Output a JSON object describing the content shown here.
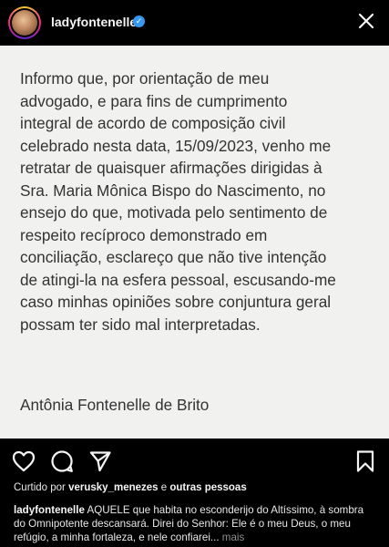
{
  "header": {
    "username": "ladyfontenelle",
    "verified_icon": "✓"
  },
  "post": {
    "body": "Informo que, por orientação de meu\nadvogado, e para fins de cumprimento\nintegral de acordo de composição civil\ncelebrado nesta data, 15/09/2023, venho me\nretratar de quaisquer afirmações dirigidas à\nSra. Maria Mônica Bispo do Nascimento, no\nensejo do que, motivada pelo sentimento de\nrespeito recíproco demonstrado em\nconciliação, esclareço que não tive intenção\nde atingi-la na esfera pessoal, escusando-me\ncaso minhas opiniões sobre conjuntura geral\npossam ter sido mal interpretadas.",
    "signature": "Antônia Fontenelle de Brito"
  },
  "likes": {
    "prefix": "Curtido por ",
    "user": "verusky_menezes",
    "middle": " e ",
    "others": "outras pessoas"
  },
  "caption": {
    "user": "ladyfontenelle",
    "text": " AQUELE que habita no esconderijo do Altíssimo, à sombra do Omnipotente descansará. Direi do Senhor: Ele é o meu Deus, o meu refúgio, a minha fortaleza, e nele confiarei... ",
    "more": "mais"
  },
  "colors": {
    "background": "#000000",
    "post_background": "#f1f1f0",
    "post_text": "#333333",
    "verified": "#3897f0"
  }
}
